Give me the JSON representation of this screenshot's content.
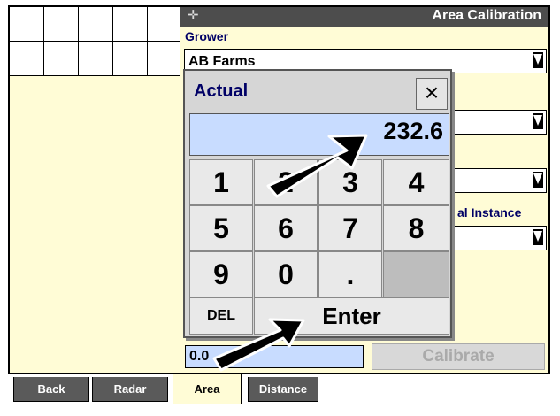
{
  "title": "Area Calibration",
  "grower": {
    "label": "Grower",
    "value": "AB Farms"
  },
  "partial_label": "al Instance",
  "bottom": {
    "input_value": "0.0",
    "calibrate_label": "Calibrate"
  },
  "tabs": [
    {
      "label": "Back"
    },
    {
      "label": "Radar"
    },
    {
      "label": "Area"
    },
    {
      "label": "Distance"
    }
  ],
  "keypad": {
    "title": "Actual",
    "close_label": "×",
    "display_value": "232.6",
    "keys": [
      "1",
      "2",
      "3",
      "4",
      "5",
      "6",
      "7",
      "8",
      "9",
      "0",
      "."
    ],
    "del_label": "DEL",
    "enter_label": "Enter"
  },
  "colors": {
    "title_bar": "#4d4d4d",
    "panel_bg": "#fffcd6",
    "display_bg": "#c8dcff",
    "label_text": "#000066"
  },
  "icons": {
    "crosshair": "crosshair-icon",
    "close": "close-icon",
    "dropdown": "dropdown-arrow-icon",
    "callout": "arrow-pointer"
  }
}
